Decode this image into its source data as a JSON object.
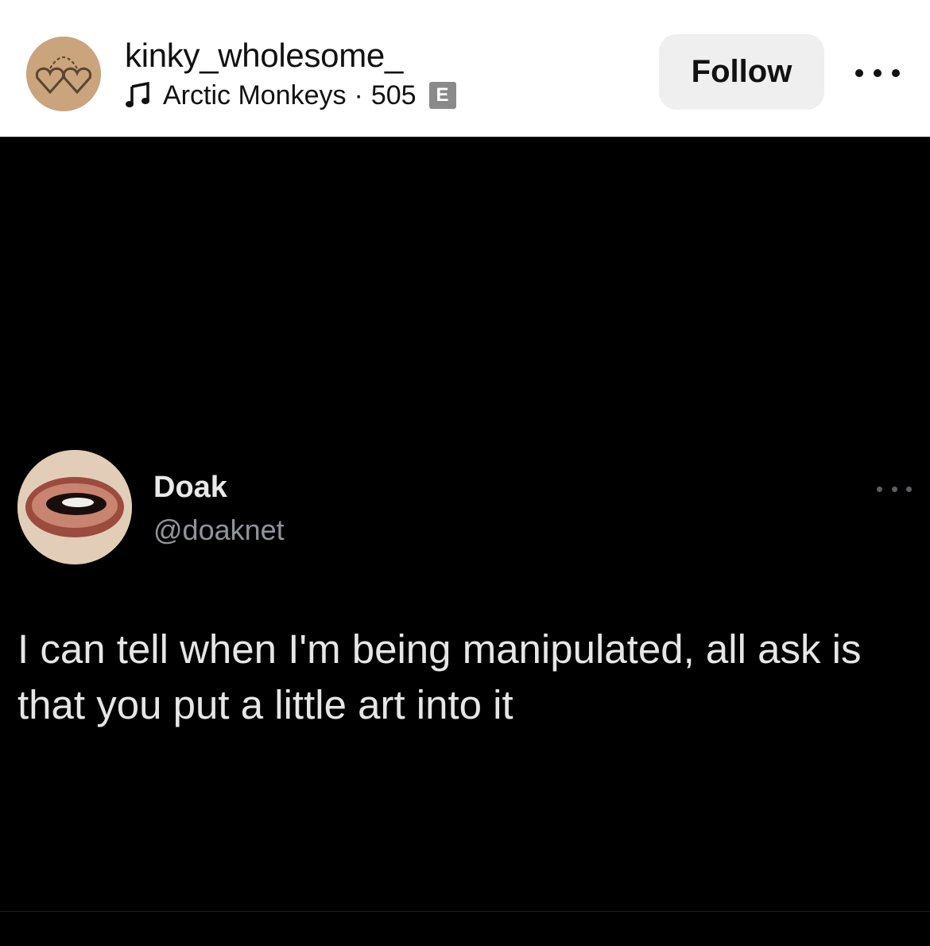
{
  "header": {
    "username": "kinky_wholesome_",
    "audio": {
      "artist": "Arctic Monkeys",
      "separator": "·",
      "count": "505",
      "explicit_badge": "E"
    },
    "follow_label": "Follow",
    "more_icon": "more-horizontal-icon",
    "avatar_icon": "handcuff-hearts-icon"
  },
  "tweet": {
    "display_name": "Doak",
    "handle": "@doaknet",
    "text": "I can tell when I'm being manipulated, all ask is that you put a little art into it",
    "more_icon": "more-horizontal-icon"
  },
  "colors": {
    "header_bg": "#ffffff",
    "post_bg": "#000000",
    "follow_bg": "#efefef",
    "tweet_text": "#e6e6e6",
    "tweet_handle": "#8f959b"
  }
}
